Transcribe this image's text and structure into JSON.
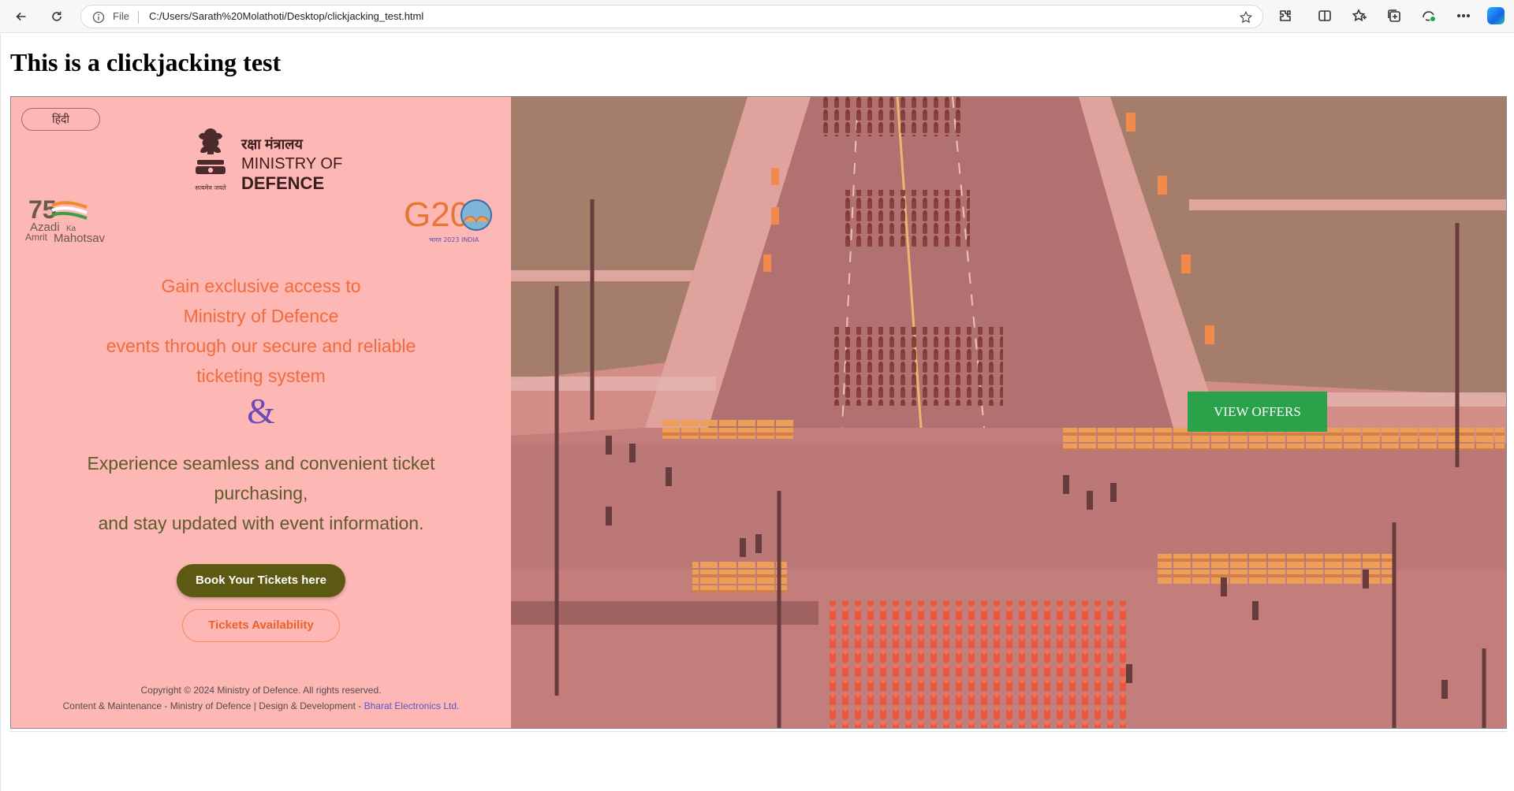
{
  "browser": {
    "scheme_label": "File",
    "url": "C:/Users/Sarath%20Molathoti/Desktop/clickjacking_test.html",
    "icons": [
      "back-icon",
      "reload-icon",
      "info-icon",
      "favorite-star-icon",
      "extensions-icon",
      "split-screen-icon",
      "favorites-icon",
      "collections-icon",
      "browser-essentials-icon",
      "more-icon",
      "copilot-icon"
    ]
  },
  "page": {
    "title": "This is a clickjacking test"
  },
  "frame": {
    "language_button": "हिंदी",
    "ministry": {
      "hindi": "रक्षा मंत्रालय",
      "line1": "MINISTRY OF",
      "line2": "DEFENCE",
      "motto": "सत्यमेव जयते"
    },
    "azadi_logo": {
      "line1": "Azadi",
      "ka": "Ka",
      "amrit": "Amrit",
      "mahotsav": "Mahotsav"
    },
    "g20_logo": {
      "text": "G20",
      "sub": "भारत 2023 INDIA"
    },
    "headline_lines": [
      "Gain exclusive access to",
      "Ministry of Defence",
      "events through our secure and reliable",
      "ticketing system"
    ],
    "ampersand": "&",
    "subline_lines": [
      "Experience seamless and convenient ticket",
      "purchasing,",
      "and stay updated with event information."
    ],
    "book_button": "Book Your Tickets here",
    "availability_button": "Tickets Availability",
    "copyright": "Copyright © 2024 Ministry of Defence. All rights reserved.",
    "credits_prefix": "Content & Maintenance - Ministry of Defence | Design & Development - ",
    "credits_link": "Bharat Electronics Ltd.",
    "overlay_button": "VIEW OFFERS"
  },
  "colors": {
    "panel_bg": "#fdb7b5",
    "headline": "#f26b3a",
    "ampersand": "#6a4bb8",
    "subline": "#5e5a2c",
    "book_button_bg": "#5c5a12",
    "availability_border": "#f08a5d",
    "view_offers_bg": "#2aa24a",
    "credits_link": "#5b56c8"
  }
}
